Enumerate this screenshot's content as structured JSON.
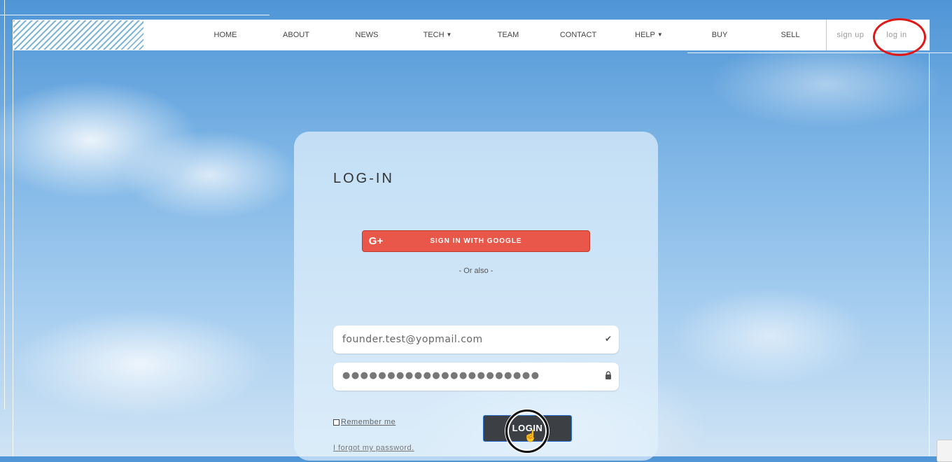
{
  "navbar": {
    "items": [
      {
        "label": "HOME"
      },
      {
        "label": "ABOUT"
      },
      {
        "label": "NEWS"
      },
      {
        "label": "TECH"
      },
      {
        "label": "TEAM"
      },
      {
        "label": "CONTACT"
      },
      {
        "label": "HELP"
      },
      {
        "label": "BUY"
      },
      {
        "label": "SELL"
      }
    ],
    "sign_up": "sign up",
    "log_in": "log in"
  },
  "login_card": {
    "title": "LOG-IN",
    "google_button": "SIGN IN WITH GOOGLE",
    "google_icon_text": "G+",
    "separator": "- Or also -",
    "email_value": "founder.test@yopmail.com",
    "password_mask": "●●●●●●●●●●●●●●●●●●●●●●",
    "remember_label": "Remember me",
    "login_button": "LOGIN",
    "forgot_link": "I forgot my password."
  }
}
